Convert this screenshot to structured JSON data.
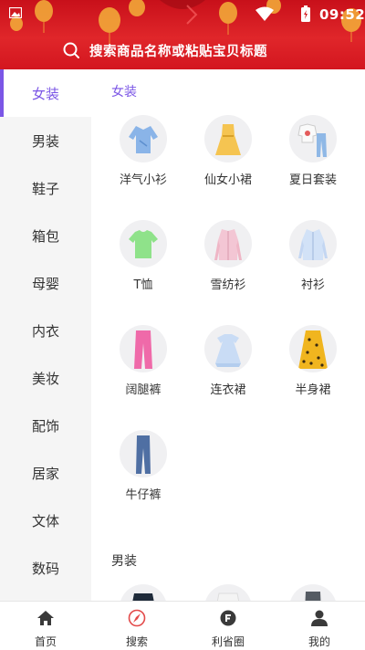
{
  "status_bar": {
    "time": "09:52"
  },
  "search": {
    "placeholder": "搜索商品名称或粘贴宝贝标题"
  },
  "sidebar": {
    "items": [
      {
        "label": "女装",
        "active": true
      },
      {
        "label": "男装"
      },
      {
        "label": "鞋子"
      },
      {
        "label": "箱包"
      },
      {
        "label": "母婴"
      },
      {
        "label": "内衣"
      },
      {
        "label": "美妆"
      },
      {
        "label": "配饰"
      },
      {
        "label": "居家"
      },
      {
        "label": "文体"
      },
      {
        "label": "数码"
      }
    ]
  },
  "content": {
    "sections": [
      {
        "title": "女装",
        "items": [
          {
            "label": "洋气小衫",
            "icon": "blouse-icon"
          },
          {
            "label": "仙女小裙",
            "icon": "dress-icon"
          },
          {
            "label": "夏日套装",
            "icon": "outfit-set-icon"
          },
          {
            "label": "T恤",
            "icon": "tshirt-icon"
          },
          {
            "label": "雪纺衫",
            "icon": "chiffon-shirt-icon"
          },
          {
            "label": "衬衫",
            "icon": "shirt-icon"
          },
          {
            "label": "阔腿裤",
            "icon": "wide-leg-pants-icon"
          },
          {
            "label": "连衣裙",
            "icon": "one-piece-dress-icon"
          },
          {
            "label": "半身裙",
            "icon": "skirt-icon"
          },
          {
            "label": "牛仔裤",
            "icon": "jeans-icon"
          }
        ]
      },
      {
        "title": "男装"
      }
    ]
  },
  "bottom_nav": {
    "items": [
      {
        "label": "首页",
        "icon": "home-icon"
      },
      {
        "label": "搜索",
        "icon": "search-compass-icon"
      },
      {
        "label": "利省圈",
        "icon": "circle-icon"
      },
      {
        "label": "我的",
        "icon": "profile-icon"
      }
    ]
  },
  "colors": {
    "accent": "#7b56e6",
    "header": "#d8161f",
    "sidebar_bg": "#f5f5f5"
  }
}
